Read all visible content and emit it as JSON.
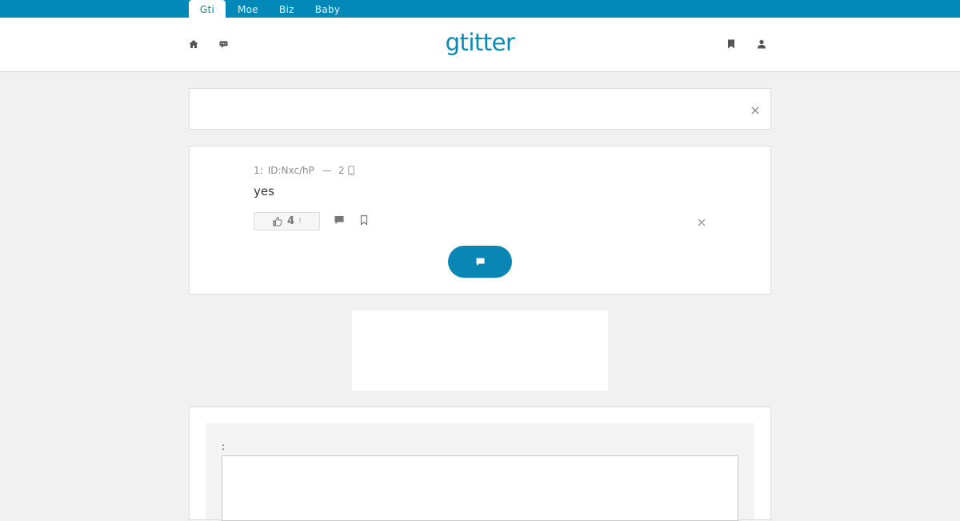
{
  "top_tabs": [
    {
      "label": "Gti",
      "active": true
    },
    {
      "label": "Moe",
      "active": false
    },
    {
      "label": "Biz",
      "active": false
    },
    {
      "label": "Baby",
      "active": false
    }
  ],
  "header": {
    "logo": "gtitter",
    "icons": [
      "home-icon",
      "chat-icon",
      "bookmark-icon",
      "user-icon"
    ]
  },
  "post": {
    "number": "1:",
    "id": "ID:Nxc/hP",
    "separator": "—",
    "count": "2",
    "device_icon": "mobile-icon",
    "body": "yes",
    "likes": "4",
    "like_mark": "!"
  },
  "compose": {
    "label": ":"
  },
  "colors": {
    "accent": "#0088b8",
    "background": "#f1f1f1"
  }
}
